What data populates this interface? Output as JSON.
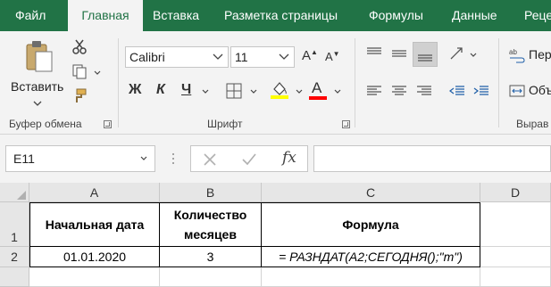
{
  "tabs": [
    "Файл",
    "Главная",
    "Вставка",
    "Разметка страницы",
    "Формулы",
    "Данные",
    "Реце"
  ],
  "clipboard": {
    "paste_label": "Вставить",
    "group_label": "Буфер обмена"
  },
  "font": {
    "name": "Calibri",
    "size": "11",
    "bold_label": "Ж",
    "italic_label": "К",
    "underline_label": "Ч",
    "grow_label": "A",
    "shrink_label": "A",
    "font_color_label": "A",
    "group_label": "Шрифт",
    "highlight_color": "#ffff00",
    "font_color": "#ff0000"
  },
  "alignment": {
    "wrap_label": "Пер",
    "merge_label": "Объ",
    "group_label": "Вырав"
  },
  "formula_bar": {
    "name_box": "E11",
    "fx_label": "fx",
    "formula": ""
  },
  "sheet": {
    "columns": [
      "A",
      "B",
      "C",
      "D"
    ],
    "rows": [
      "1",
      "2"
    ],
    "cells": {
      "A1": "Начальная дата",
      "B1": "Количество месяцев",
      "C1": "Формула",
      "A2": "01.01.2020",
      "B2": "3",
      "C2": "= РАЗНДАТ(A2;СЕГОДНЯ();\"m\")"
    }
  },
  "colors": {
    "brand": "#217346",
    "ribbon": "#f3f3f3"
  }
}
